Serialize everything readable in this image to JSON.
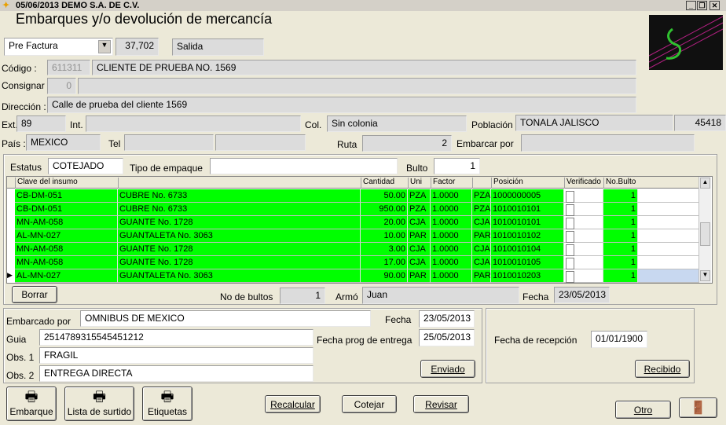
{
  "window": {
    "title": "05/06/2013 DEMO S.A. DE C.V.",
    "heading": "Embarques y/o devolución de mercancía"
  },
  "doc": {
    "type": "Pre Factura",
    "number": "37,702",
    "movement": "Salida"
  },
  "client": {
    "code_label": "Código :",
    "code": "611311",
    "name": "CLIENTE DE PRUEBA NO. 1569",
    "consignar_label": "Consignar",
    "consignar_code": "0",
    "consignar_name": "",
    "direccion_label": "Dirección :",
    "direccion": "Calle de prueba del cliente 1569",
    "ext_label": "Ext.",
    "ext": "89",
    "int_label": "Int.",
    "int": "",
    "col_label": "Col.",
    "col": "Sin colonia",
    "poblacion_label": "Población",
    "poblacion": "TONALA JALISCO",
    "cp": "45418",
    "pais_label": "País :",
    "pais": "MEXICO",
    "tel_label": "Tel",
    "tel1": "",
    "tel2": "",
    "ruta_label": "Ruta",
    "ruta": "2",
    "embarcar_label": "Embarcar por",
    "embarcar": ""
  },
  "status": {
    "estatus_label": "Estatus",
    "estatus": "COTEJADO",
    "empaque_label": "Tipo de empaque",
    "empaque": "",
    "bulto_label": "Bulto",
    "bulto": "1"
  },
  "table": {
    "headers": [
      "Clave del insumo",
      "Cantidad",
      "Uni",
      "Factor",
      "Posición",
      "Verificado",
      "No.Bulto"
    ],
    "rows": [
      {
        "clave": "CB-DM-051",
        "desc": "CUBRE No. 6733",
        "cant": "50.00",
        "uni": "PZA",
        "factor": "1.0000",
        "uni2": "PZA",
        "pos": "1000000005",
        "ver": "Si",
        "bulto": "1"
      },
      {
        "clave": "CB-DM-051",
        "desc": "CUBRE No. 6733",
        "cant": "950.00",
        "uni": "PZA",
        "factor": "1.0000",
        "uni2": "PZA",
        "pos": "1010010101",
        "ver": "Si",
        "bulto": "1"
      },
      {
        "clave": "MN-AM-058",
        "desc": "GUANTE No. 1728",
        "cant": "20.00",
        "uni": "CJA",
        "factor": "1.0000",
        "uni2": "CJA",
        "pos": "1010010101",
        "ver": "Si",
        "bulto": "1"
      },
      {
        "clave": "AL-MN-027",
        "desc": "GUANTALETA No. 3063",
        "cant": "10.00",
        "uni": "PAR",
        "factor": "1.0000",
        "uni2": "PAR",
        "pos": "1010010102",
        "ver": "Si",
        "bulto": "1"
      },
      {
        "clave": "MN-AM-058",
        "desc": "GUANTE No. 1728",
        "cant": "3.00",
        "uni": "CJA",
        "factor": "1.0000",
        "uni2": "CJA",
        "pos": "1010010104",
        "ver": "Si",
        "bulto": "1"
      },
      {
        "clave": "MN-AM-058",
        "desc": "GUANTE No. 1728",
        "cant": "17.00",
        "uni": "CJA",
        "factor": "1.0000",
        "uni2": "CJA",
        "pos": "1010010105",
        "ver": "Si",
        "bulto": "1"
      },
      {
        "clave": "AL-MN-027",
        "desc": "GUANTALETA No. 3063",
        "cant": "90.00",
        "uni": "PAR",
        "factor": "1.0000",
        "uni2": "PAR",
        "pos": "1010010203",
        "ver": "Si",
        "bulto": "1"
      }
    ]
  },
  "summary": {
    "borrar": "Borrar",
    "bultos_label": "No de bultos",
    "bultos": "1",
    "armo_label": "Armó",
    "armo": "Juan",
    "fecha_label": "Fecha",
    "fecha": "23/05/2013"
  },
  "shipping": {
    "embarcado_label": "Embarcado por",
    "embarcado": "OMNIBUS DE MEXICO",
    "fecha_label": "Fecha",
    "fecha": "23/05/2013",
    "guia_label": "Guia",
    "guia": "2514789315545451212",
    "prog_label": "Fecha prog de entrega",
    "prog": "25/05/2013",
    "obs1_label": "Obs. 1",
    "obs1": "FRAGIL",
    "obs2_label": "Obs. 2",
    "obs2": "ENTREGA DIRECTA",
    "enviado": "Enviado",
    "recepcion_label": "Fecha de recepción",
    "recepcion": "01/01/1900",
    "recibido": "Recibido"
  },
  "toolbar": {
    "embarque": "Embarque",
    "surtido": "Lista de surtido",
    "etiquetas": "Etiquetas",
    "recalcular": "Recalcular",
    "cotejar": "Cotejar",
    "revisar": "Revisar",
    "otro": "Otro"
  },
  "colors": {
    "row_green": "#00ff00",
    "selected": "#c8d8f0"
  }
}
